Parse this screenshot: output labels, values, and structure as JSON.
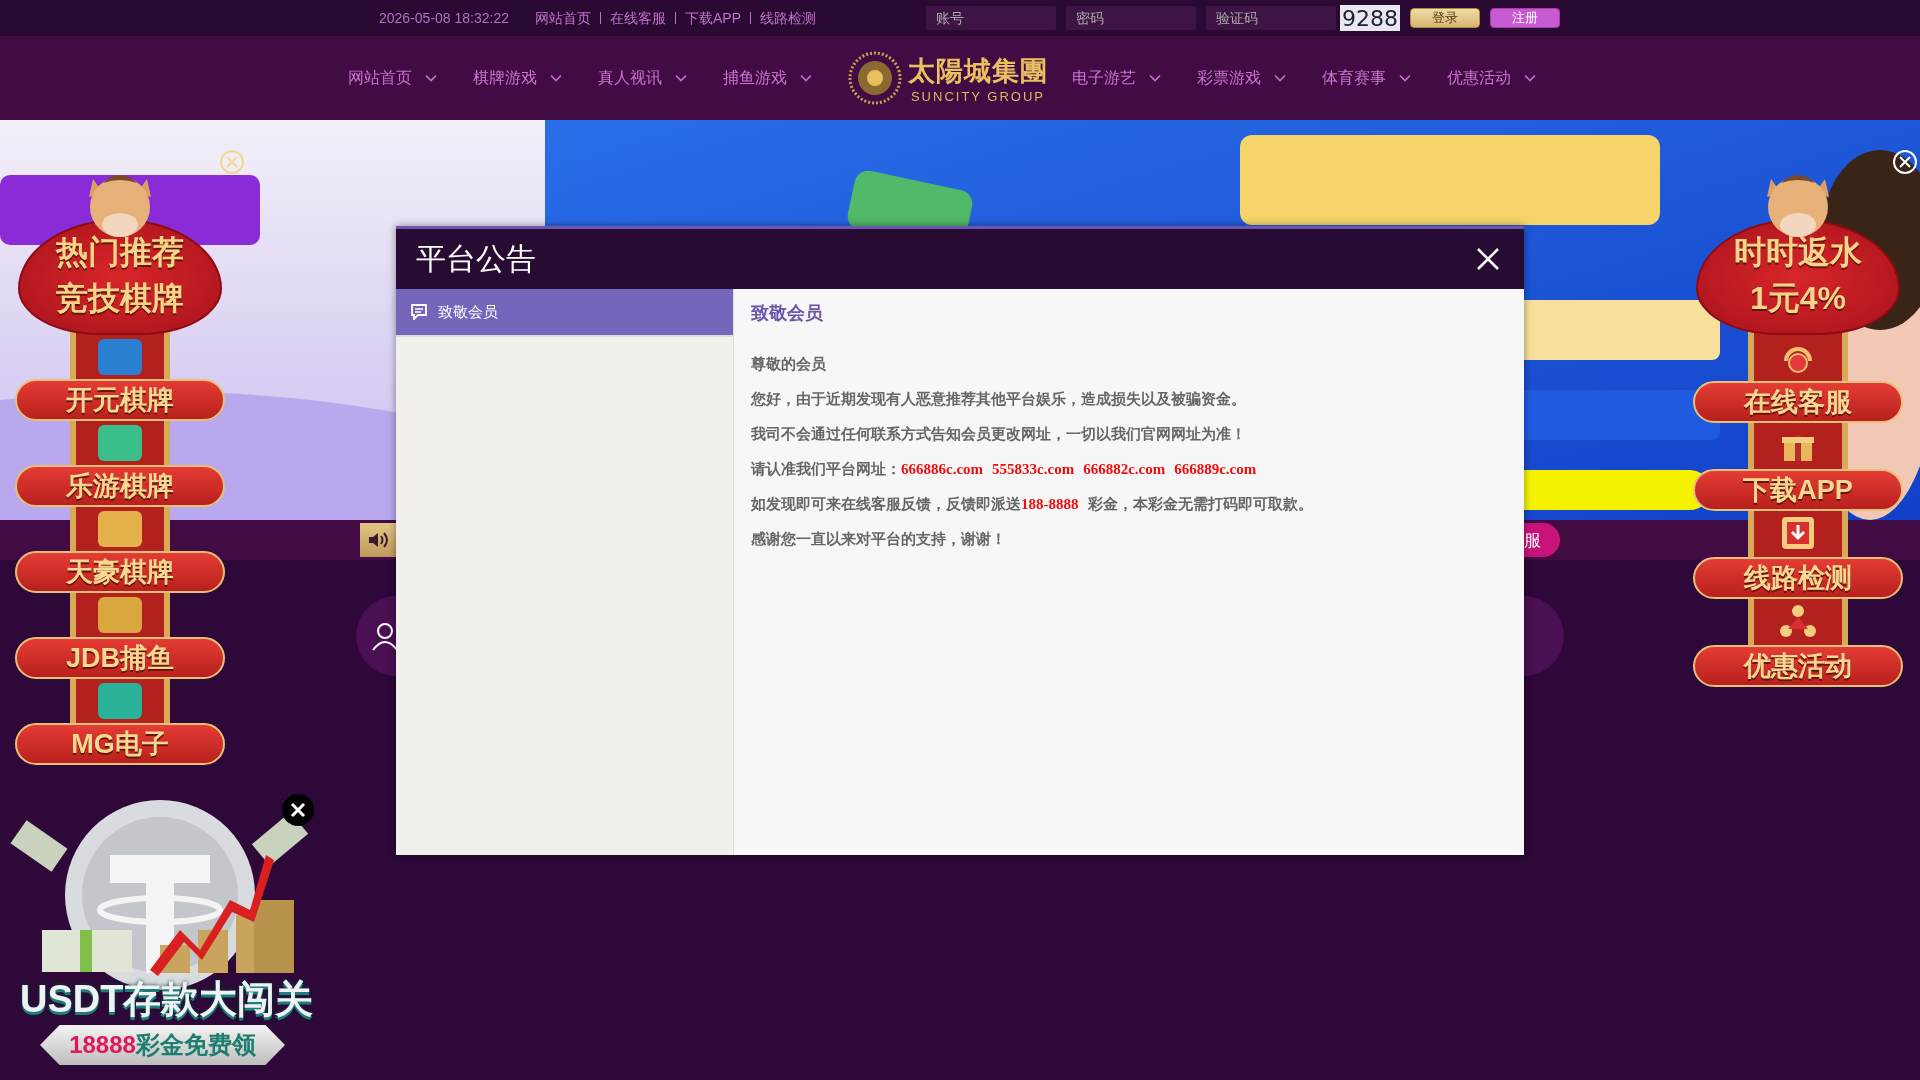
{
  "top_bar": {
    "datetime": "2026-05-08 18:32:22",
    "links": [
      "网站首页",
      "在线客服",
      "下载APP",
      "线路检测"
    ],
    "login": {
      "fields": [
        {
          "placeholder": "账号"
        },
        {
          "placeholder": "密码"
        },
        {
          "placeholder": "验证码"
        }
      ],
      "captcha_code": "9288",
      "buttons": [
        {
          "label": "登录",
          "kind": "login"
        },
        {
          "label": "注册",
          "kind": "register"
        }
      ]
    }
  },
  "nav": {
    "left": [
      "网站首页",
      "棋牌游戏",
      "真人视讯",
      "捕鱼游戏"
    ],
    "logo": {
      "title": "太陽城集團",
      "subtitle": "SUNCITY GROUP"
    },
    "right": [
      "电子游艺",
      "彩票游戏",
      "体育赛事",
      "优惠活动"
    ]
  },
  "strip": {
    "service_button": "服"
  },
  "left_float": {
    "heading": [
      "热门推荐",
      "竞技棋牌"
    ],
    "items": [
      {
        "label": "开元棋牌",
        "color": "#2a7fd0"
      },
      {
        "label": "乐游棋牌",
        "color": "#3bbf8a"
      },
      {
        "label": "天豪棋牌",
        "color": "#e6b04a"
      },
      {
        "label": "JDB捕鱼",
        "color": "#d9a640"
      },
      {
        "label": "MG电子",
        "color": "#2bb39a"
      }
    ]
  },
  "right_float": {
    "heading": [
      "时时返水",
      "1元4%"
    ],
    "items": [
      {
        "label": "在线客服",
        "kind": "headset"
      },
      {
        "label": "下载APP",
        "kind": "gift"
      },
      {
        "label": "线路检测",
        "kind": "download"
      },
      {
        "label": "优惠活动",
        "kind": "people"
      }
    ]
  },
  "usdt_ad": {
    "title": "USDT存款大闯关",
    "prize": "18888",
    "prize_text": "彩金免费领"
  },
  "modal": {
    "title": "平台公告",
    "tabs": [
      {
        "label": "致敬会员",
        "selected": true
      }
    ],
    "article": {
      "title": "致敬会员",
      "paragraphs": [
        [
          {
            "text": "尊敬的会员",
            "highlight": false
          }
        ],
        [
          {
            "text": "您好，由于近期发现有人恶意推荐其他平台娱乐，造成损失以及被骗资金。",
            "highlight": false
          }
        ],
        [
          {
            "text": "我司不会通过任何联系方式告知会员更改网址，一切以我们官网网址为准！",
            "highlight": false
          }
        ],
        [
          {
            "text": "请认准我们平台网址：",
            "highlight": false
          },
          {
            "text": "666886c.com",
            "highlight": true
          },
          {
            "text": "555833c.com",
            "highlight": true
          },
          {
            "text": "666882c.com",
            "highlight": true
          },
          {
            "text": "666889c.com",
            "highlight": true
          }
        ],
        [
          {
            "text": "如发现即可来在线客服反馈，反馈即派送",
            "highlight": false
          },
          {
            "text": "188-8888",
            "highlight": true
          },
          {
            "text": "彩金，本彩金无需打码即可取款。",
            "highlight": false
          }
        ],
        [
          {
            "text": "感谢您一直以来对平台的支持，谢谢！",
            "highlight": false
          }
        ]
      ]
    }
  }
}
